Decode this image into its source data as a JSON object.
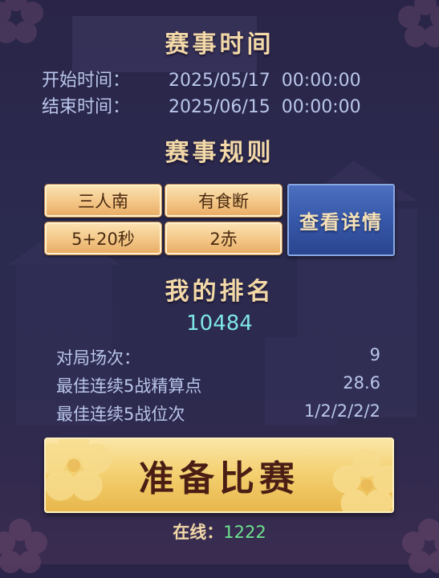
{
  "event_time": {
    "title": "赛事时间",
    "start_label": "开始时间：",
    "start_value": "2025/05/17  00:00:00",
    "end_label": "结束时间：",
    "end_value": "2025/06/15  00:00:00"
  },
  "event_rules": {
    "title": "赛事规则",
    "rules": [
      "三人南",
      "有食断",
      "5+20秒",
      "2赤"
    ],
    "detail_button": "查看详情"
  },
  "my_ranking": {
    "title": "我的排名",
    "rank": "10484",
    "stats": [
      {
        "label": "对局场次：",
        "value": "9"
      },
      {
        "label": "最佳连续5战精算点",
        "value": "28.6"
      },
      {
        "label": "最佳连续5战位次",
        "value": "1/2/2/2/2"
      }
    ]
  },
  "start_button": "准备比赛",
  "online": {
    "label": "在线：",
    "value": "1222"
  },
  "colors": {
    "gold_text": "#f3d9a8",
    "rank_cyan": "#7fe6e8",
    "online_green": "#6ee38e",
    "detail_blue": "#3556a6"
  }
}
